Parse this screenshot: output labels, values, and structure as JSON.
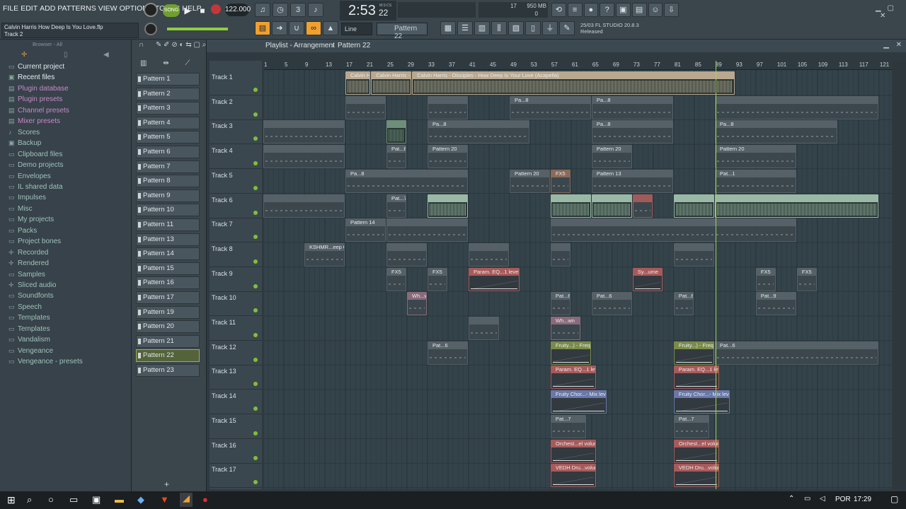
{
  "menu": [
    "FILE",
    "EDIT",
    "ADD",
    "PATTERNS",
    "VIEW",
    "OPTIONS",
    "TOOLS",
    "HELP"
  ],
  "transport": {
    "mode": "SONG",
    "tempo": "122.000",
    "time": "2:53",
    "time_sub": "22",
    "time_unit": "M:S:CS",
    "cpu": "17",
    "mem": "950 MB",
    "mem2": "0"
  },
  "project": {
    "file": "Calvin Harris How Deep Is You Love.flp",
    "hint": "Track 2"
  },
  "snap": "Line",
  "pattern_selector": "Pattern 22",
  "news": {
    "date": "25/03",
    "version": "FL STUDIO 20.8.3",
    "status": "Released"
  },
  "browser": {
    "header": "Browser - All",
    "items": [
      {
        "label": "Current project",
        "icon": "folder-icon"
      },
      {
        "label": "Recent files",
        "icon": "recent-icon"
      },
      {
        "label": "Plugin database",
        "icon": "plugin-icon"
      },
      {
        "label": "Plugin presets",
        "icon": "plugin-icon"
      },
      {
        "label": "Channel presets",
        "icon": "channel-icon"
      },
      {
        "label": "Mixer presets",
        "icon": "mixer-icon"
      },
      {
        "label": "Scores",
        "icon": "note-icon"
      },
      {
        "label": "Backup",
        "icon": "backup-icon"
      },
      {
        "label": "Clipboard files",
        "icon": "folder-icon"
      },
      {
        "label": "Demo projects",
        "icon": "folder-icon"
      },
      {
        "label": "Envelopes",
        "icon": "folder-icon"
      },
      {
        "label": "IL shared data",
        "icon": "folder-icon"
      },
      {
        "label": "Impulses",
        "icon": "folder-icon"
      },
      {
        "label": "Misc",
        "icon": "folder-icon"
      },
      {
        "label": "My projects",
        "icon": "folder-icon"
      },
      {
        "label": "Packs",
        "icon": "folder-icon"
      },
      {
        "label": "Project bones",
        "icon": "folder-icon"
      },
      {
        "label": "Recorded",
        "icon": "plus-icon"
      },
      {
        "label": "Rendered",
        "icon": "plus-icon"
      },
      {
        "label": "Samples",
        "icon": "folder-icon"
      },
      {
        "label": "Sliced audio",
        "icon": "plus-icon"
      },
      {
        "label": "Soundfonts",
        "icon": "folder-icon"
      },
      {
        "label": "Speech",
        "icon": "folder-icon"
      },
      {
        "label": "Templates",
        "icon": "folder-icon"
      },
      {
        "label": "Templates",
        "icon": "folder-icon"
      },
      {
        "label": "Vandalism",
        "icon": "folder-icon"
      },
      {
        "label": "Vengeance",
        "icon": "folder-icon"
      },
      {
        "label": "Vengeance - presets",
        "icon": "folder-icon"
      }
    ]
  },
  "patterns": [
    "Pattern 1",
    "Pattern 2",
    "Pattern 3",
    "Pattern 4",
    "Pattern 5",
    "Pattern 6",
    "Pattern 7",
    "Pattern 8",
    "Pattern 9",
    "Pattern 10",
    "Pattern 11",
    "Pattern 13",
    "Pattern 14",
    "Pattern 15",
    "Pattern 16",
    "Pattern 17",
    "Pattern 19",
    "Pattern 20",
    "Pattern 21",
    "Pattern 22",
    "Pattern 23"
  ],
  "selected_pattern": "Pattern 22",
  "playlist": {
    "title": "Playlist - Arrangement",
    "sep": "›",
    "pattern": "Pattern 22"
  },
  "ruler": [
    "1",
    "5",
    "9",
    "13",
    "17",
    "21",
    "25",
    "29",
    "33",
    "37",
    "41",
    "45",
    "49",
    "53",
    "57",
    "61",
    "65",
    "69",
    "73",
    "77",
    "81",
    "85",
    "89",
    "93",
    "97",
    "101",
    "105",
    "109",
    "113",
    "117",
    "121"
  ],
  "tracks": [
    "Track 1",
    "Track 2",
    "Track 3",
    "Track 4",
    "Track 5",
    "Track 6",
    "Track 7",
    "Track 8",
    "Track 9",
    "Track 10",
    "Track 11",
    "Track 12",
    "Track 13",
    "Track 14",
    "Track 15",
    "Track 16",
    "Track 17"
  ],
  "clips": [
    {
      "track": 0,
      "start": 17,
      "len": 5,
      "label": "Calvin Ha...apella]",
      "color": "#b9a890",
      "type": "audio"
    },
    {
      "track": 0,
      "start": 22,
      "len": 8,
      "label": "Calvin Harris - Dis...r Love (Acapella)",
      "color": "#b9a890",
      "type": "audio"
    },
    {
      "track": 0,
      "start": 30,
      "len": 63,
      "label": "Calvin Harris - Disciples - How Deep Is Your Love (Acapella)",
      "color": "#b9a890",
      "type": "audio"
    },
    {
      "track": 1,
      "start": 17,
      "len": 8,
      "label": "",
      "color": "#556067",
      "type": "pat"
    },
    {
      "track": 1,
      "start": 33,
      "len": 8,
      "label": "",
      "color": "#556067",
      "type": "pat"
    },
    {
      "track": 1,
      "start": 49,
      "len": 16,
      "label": "Pa...8",
      "color": "#556067",
      "type": "pat"
    },
    {
      "track": 1,
      "start": 65,
      "len": 16,
      "label": "Pa...8",
      "color": "#556067",
      "type": "pat"
    },
    {
      "track": 1,
      "start": 89,
      "len": 32,
      "label": "",
      "color": "#556067",
      "type": "pat"
    },
    {
      "track": 2,
      "start": 1,
      "len": 16,
      "label": "",
      "color": "#556067",
      "type": "pat"
    },
    {
      "track": 2,
      "start": 25,
      "len": 4,
      "label": "",
      "color": "#6f8e7a",
      "type": "audio"
    },
    {
      "track": 2,
      "start": 33,
      "len": 20,
      "label": "Pa...8",
      "color": "#556067",
      "type": "pat"
    },
    {
      "track": 2,
      "start": 65,
      "len": 16,
      "label": "Pa...8",
      "color": "#556067",
      "type": "pat"
    },
    {
      "track": 2,
      "start": 89,
      "len": 24,
      "label": "Pa...8",
      "color": "#556067",
      "type": "pat"
    },
    {
      "track": 3,
      "start": 1,
      "len": 16,
      "label": "",
      "color": "#556067",
      "type": "pat"
    },
    {
      "track": 3,
      "start": 25,
      "len": 4,
      "label": "Pat...6",
      "color": "#556067",
      "type": "pat"
    },
    {
      "track": 3,
      "start": 33,
      "len": 8,
      "label": "Pattern 20",
      "color": "#556067",
      "type": "pat"
    },
    {
      "track": 3,
      "start": 65,
      "len": 8,
      "label": "Pattern 20",
      "color": "#556067",
      "type": "pat"
    },
    {
      "track": 3,
      "start": 89,
      "len": 16,
      "label": "Pattern 20",
      "color": "#556067",
      "type": "pat"
    },
    {
      "track": 4,
      "start": 17,
      "len": 24,
      "label": "Pa...8",
      "color": "#556067",
      "type": "pat"
    },
    {
      "track": 4,
      "start": 49,
      "len": 8,
      "label": "Pattern 20",
      "color": "#556067",
      "type": "pat"
    },
    {
      "track": 4,
      "start": 57,
      "len": 4,
      "label": "FX5",
      "color": "#8a6a5a",
      "type": "pat"
    },
    {
      "track": 4,
      "start": 65,
      "len": 16,
      "label": "Pattern 13",
      "color": "#556067",
      "type": "pat"
    },
    {
      "track": 4,
      "start": 89,
      "len": 16,
      "label": "Pat...1",
      "color": "#556067",
      "type": "pat"
    },
    {
      "track": 5,
      "start": 1,
      "len": 16,
      "label": "",
      "color": "#556067",
      "type": "pat"
    },
    {
      "track": 5,
      "start": 25,
      "len": 4,
      "label": "Pat...7",
      "color": "#556067",
      "type": "pat"
    },
    {
      "track": 5,
      "start": 33,
      "len": 8,
      "label": "",
      "color": "#9ab8a6",
      "type": "audio"
    },
    {
      "track": 5,
      "start": 57,
      "len": 8,
      "label": "",
      "color": "#9ab8a6",
      "type": "audio"
    },
    {
      "track": 5,
      "start": 65,
      "len": 8,
      "label": "",
      "color": "#9ab8a6",
      "type": "audio"
    },
    {
      "track": 5,
      "start": 73,
      "len": 4,
      "label": "",
      "color": "#a05a5a",
      "type": "pat"
    },
    {
      "track": 5,
      "start": 81,
      "len": 8,
      "label": "",
      "color": "#9ab8a6",
      "type": "audio"
    },
    {
      "track": 5,
      "start": 89,
      "len": 32,
      "label": "",
      "color": "#9ab8a6",
      "type": "audio"
    },
    {
      "track": 6,
      "start": 17,
      "len": 8,
      "label": "Pattern 14",
      "color": "#556067",
      "type": "pat"
    },
    {
      "track": 6,
      "start": 25,
      "len": 16,
      "label": "",
      "color": "#556067",
      "type": "pat"
    },
    {
      "track": 6,
      "start": 57,
      "len": 48,
      "label": "",
      "color": "#556067",
      "type": "pat"
    },
    {
      "track": 7,
      "start": 9,
      "len": 8,
      "label": "KSHMR...eep 01",
      "color": "#556067",
      "type": "pat"
    },
    {
      "track": 7,
      "start": 25,
      "len": 8,
      "label": "",
      "color": "#556067",
      "type": "pat"
    },
    {
      "track": 7,
      "start": 41,
      "len": 8,
      "label": "",
      "color": "#556067",
      "type": "pat"
    },
    {
      "track": 7,
      "start": 57,
      "len": 4,
      "label": "",
      "color": "#556067",
      "type": "pat"
    },
    {
      "track": 7,
      "start": 81,
      "len": 8,
      "label": "",
      "color": "#556067",
      "type": "pat"
    },
    {
      "track": 8,
      "start": 25,
      "len": 4,
      "label": "FX5",
      "color": "#556067",
      "type": "pat"
    },
    {
      "track": 8,
      "start": 33,
      "len": 4,
      "label": "FX5",
      "color": "#556067",
      "type": "pat"
    },
    {
      "track": 8,
      "start": 41,
      "len": 10,
      "label": "Param. EQ...1 level",
      "color": "#a85a5a",
      "type": "auto"
    },
    {
      "track": 8,
      "start": 73,
      "len": 6,
      "label": "Sy...ume",
      "color": "#a85a5a",
      "type": "auto"
    },
    {
      "track": 8,
      "start": 97,
      "len": 4,
      "label": "FX5",
      "color": "#556067",
      "type": "pat"
    },
    {
      "track": 8,
      "start": 105,
      "len": 4,
      "label": "FX5",
      "color": "#556067",
      "type": "pat"
    },
    {
      "track": 9,
      "start": 29,
      "len": 4,
      "label": "Wh...wn",
      "color": "#8a6a7a",
      "type": "pat"
    },
    {
      "track": 9,
      "start": 57,
      "len": 4,
      "label": "Pat...6",
      "color": "#556067",
      "type": "pat"
    },
    {
      "track": 9,
      "start": 65,
      "len": 8,
      "label": "Pat...6",
      "color": "#556067",
      "type": "pat"
    },
    {
      "track": 9,
      "start": 81,
      "len": 4,
      "label": "Pat...6",
      "color": "#556067",
      "type": "pat"
    },
    {
      "track": 9,
      "start": 97,
      "len": 8,
      "label": "Pat...9",
      "color": "#556067",
      "type": "pat"
    },
    {
      "track": 10,
      "start": 41,
      "len": 6,
      "label": "",
      "color": "#556067",
      "type": "pat"
    },
    {
      "track": 10,
      "start": 57,
      "len": 6,
      "label": "Wh...wn",
      "color": "#8a6a7a",
      "type": "pat"
    },
    {
      "track": 11,
      "start": 33,
      "len": 8,
      "label": "Pat...6",
      "color": "#556067",
      "type": "pat"
    },
    {
      "track": 11,
      "start": 57,
      "len": 8,
      "label": "Fruity...) - Freq",
      "color": "#7a8a4a",
      "type": "auto"
    },
    {
      "track": 11,
      "start": 81,
      "len": 8,
      "label": "Fruity...) - Freq",
      "color": "#7a8a4a",
      "type": "auto"
    },
    {
      "track": 11,
      "start": 89,
      "len": 32,
      "label": "Pat...6",
      "color": "#556067",
      "type": "pat"
    },
    {
      "track": 12,
      "start": 57,
      "len": 9,
      "label": "Param. EQ...1 level",
      "color": "#a85a5a",
      "type": "auto"
    },
    {
      "track": 12,
      "start": 81,
      "len": 9,
      "label": "Param. EQ...1 level",
      "color": "#a85a5a",
      "type": "auto"
    },
    {
      "track": 13,
      "start": 57,
      "len": 11,
      "label": "Fruity Chor...- Mix level",
      "color": "#6a78a8",
      "type": "auto"
    },
    {
      "track": 13,
      "start": 81,
      "len": 11,
      "label": "Fruity Chor...- Mix level",
      "color": "#6a78a8",
      "type": "auto"
    },
    {
      "track": 14,
      "start": 57,
      "len": 7,
      "label": "Pat...7",
      "color": "#556067",
      "type": "pat"
    },
    {
      "track": 14,
      "start": 81,
      "len": 7,
      "label": "Pat...7",
      "color": "#556067",
      "type": "pat"
    },
    {
      "track": 15,
      "start": 57,
      "len": 9,
      "label": "Orchest...el volume",
      "color": "#a85a5a",
      "type": "auto"
    },
    {
      "track": 15,
      "start": 81,
      "len": 9,
      "label": "Orchest...el volume",
      "color": "#a85a5a",
      "type": "auto"
    },
    {
      "track": 16,
      "start": 57,
      "len": 9,
      "label": "VEDH Dru...volume",
      "color": "#a85a5a",
      "type": "auto"
    },
    {
      "track": 16,
      "start": 81,
      "len": 9,
      "label": "VEDH Dru...volume",
      "color": "#a85a5a",
      "type": "auto"
    }
  ],
  "taskbar": {
    "lang": "POR",
    "clock": "17:29"
  },
  "colors": {
    "accent": "#7fbf3a",
    "toolbar": "#3a454c",
    "grid": "#34434a"
  }
}
